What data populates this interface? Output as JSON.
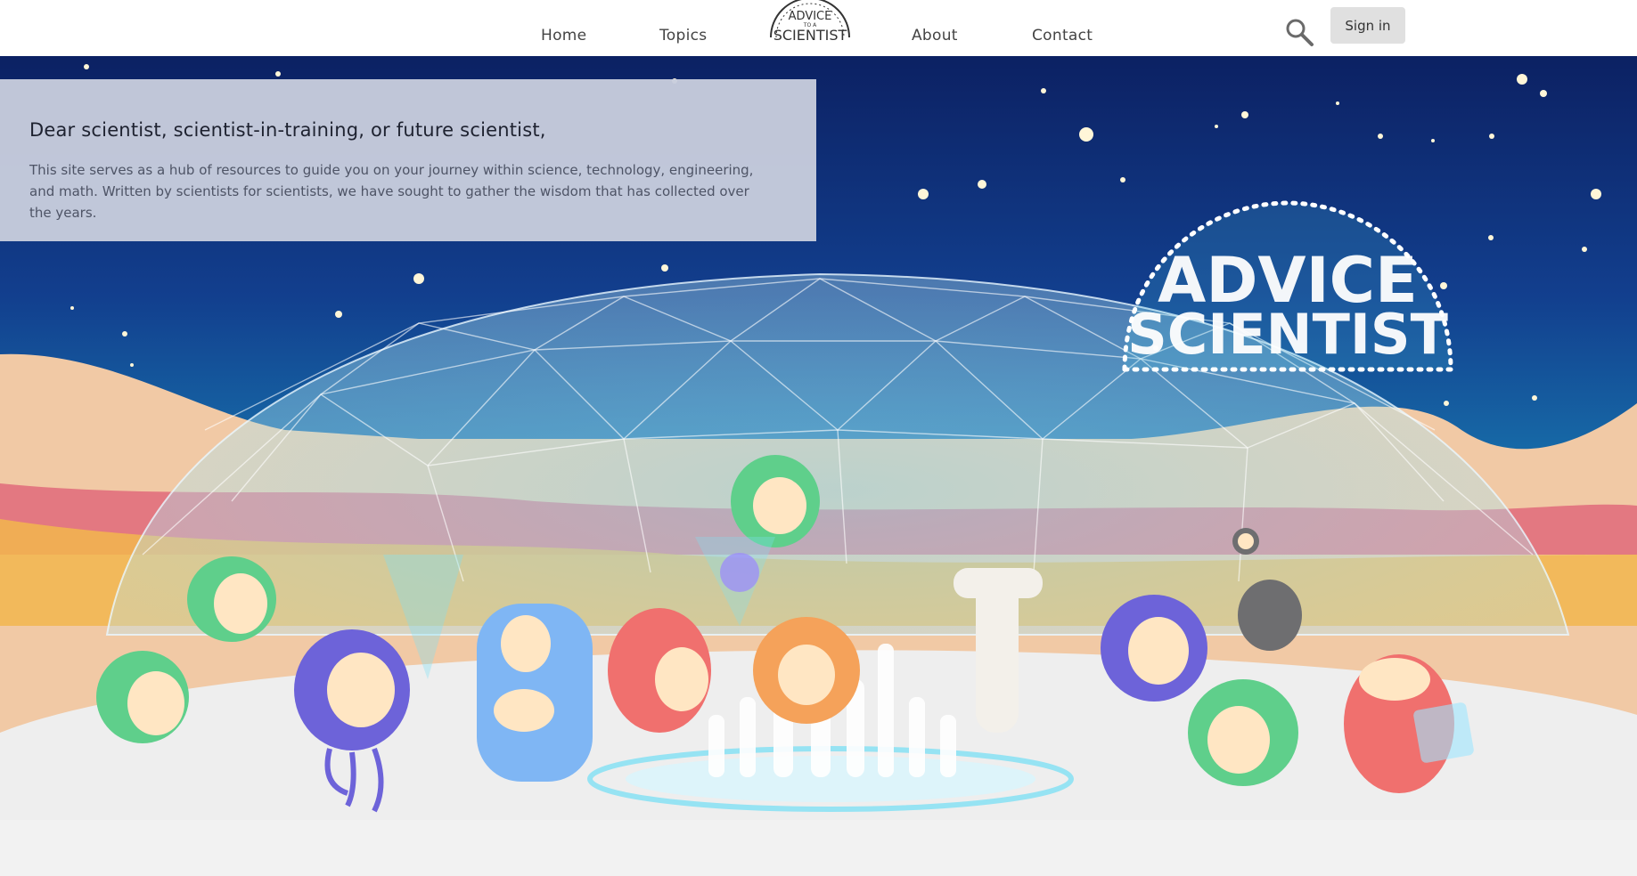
{
  "nav": {
    "home": "Home",
    "topics": "Topics",
    "about": "About",
    "contact": "Contact",
    "sign_in": "Sign in",
    "logo_icon": "advice-to-a-scientist-logo",
    "search_icon": "search-icon"
  },
  "hero": {
    "intro_title": "Dear scientist, scientist-in-training, or future scientist,",
    "intro_body": "This site serves as a hub of resources to guide you on your journey within science, technology, engineering, and math. Written by scientists for scientists, we have sought to gather the wisdom that has collected over the years.",
    "sign_logo_text": "ADVICE TO A SCIENTIST"
  },
  "colors": {
    "sky_top": "#0b2466",
    "sky_bottom": "#1a7ab0",
    "dune": "#f1c9a5",
    "floor": "#eeeeee",
    "intro_card": "#c8cddd"
  }
}
